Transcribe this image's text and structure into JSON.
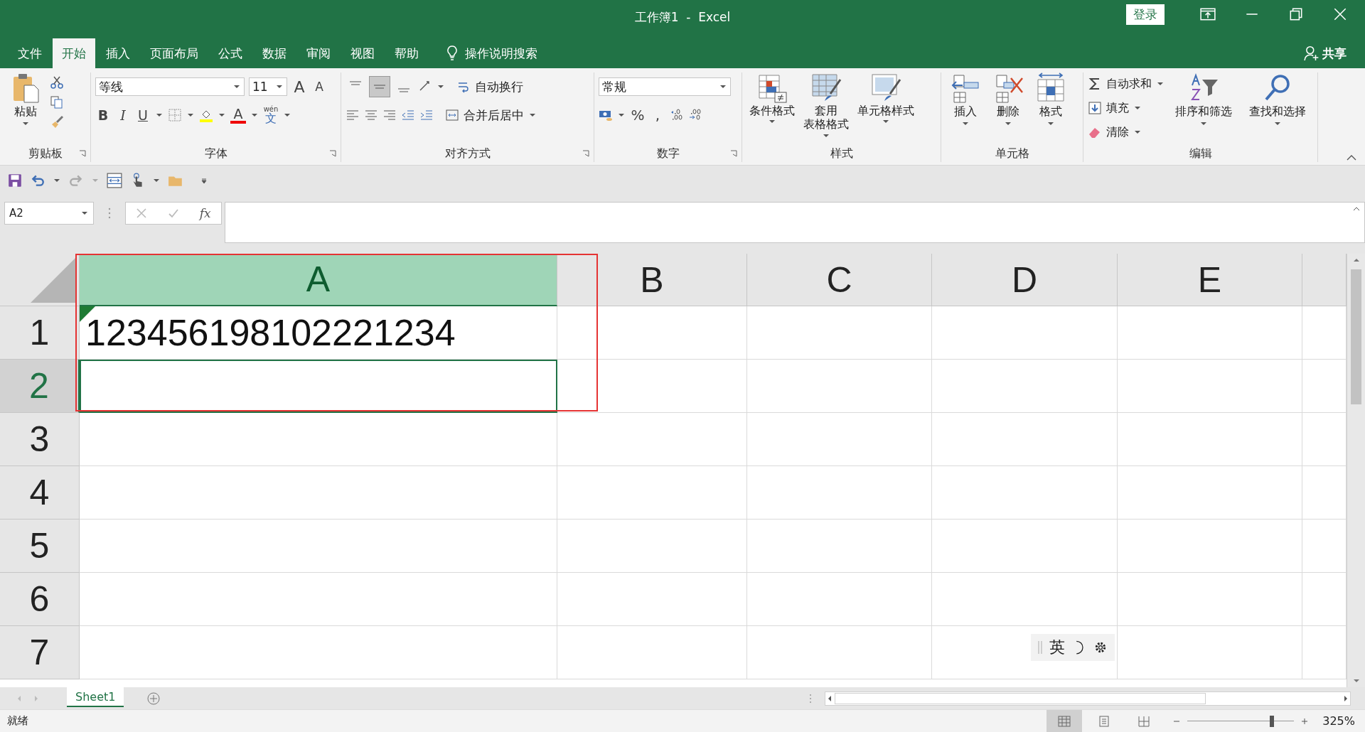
{
  "title_bar": {
    "title": "工作簿1  -  Excel",
    "login": "登录"
  },
  "tabs": [
    {
      "label": "文件",
      "selected": false
    },
    {
      "label": "开始",
      "selected": true
    },
    {
      "label": "插入",
      "selected": false
    },
    {
      "label": "页面布局",
      "selected": false
    },
    {
      "label": "公式",
      "selected": false
    },
    {
      "label": "数据",
      "selected": false
    },
    {
      "label": "审阅",
      "selected": false
    },
    {
      "label": "视图",
      "selected": false
    },
    {
      "label": "帮助",
      "selected": false
    }
  ],
  "tell_me": "操作说明搜索",
  "share": "共享",
  "ribbon": {
    "clipboard": {
      "paste": "粘贴",
      "label": "剪贴板"
    },
    "font": {
      "name": "等线",
      "size": "11",
      "label": "字体",
      "grow": "A",
      "shrink": "A",
      "bold": "B",
      "italic": "I",
      "underline": "U",
      "font_color_letter": "A",
      "phonetic_top": "wén",
      "phonetic": "文"
    },
    "alignment": {
      "vertical": [
        {
          "kind": "top",
          "selected": false
        },
        {
          "kind": "middle",
          "selected": true
        },
        {
          "kind": "bottom",
          "selected": false
        }
      ],
      "wrap": "自动换行",
      "merge": "合并后居中",
      "label": "对齐方式"
    },
    "number": {
      "format": "常规",
      "percent": "%",
      "comma": ",",
      "label": "数字"
    },
    "styles": {
      "buttons": [
        {
          "kind": "conditional",
          "lines": [
            "条件格式"
          ]
        },
        {
          "kind": "table",
          "lines": [
            "套用",
            "表格格式"
          ]
        },
        {
          "kind": "cell",
          "lines": [
            "单元格样式"
          ]
        }
      ],
      "label": "样式"
    },
    "cells": {
      "buttons": [
        {
          "kind": "insert",
          "label": "插入"
        },
        {
          "kind": "delete",
          "label": "删除"
        },
        {
          "kind": "format",
          "label": "格式"
        }
      ],
      "label": "单元格"
    },
    "editing": {
      "items": [
        {
          "kind": "sum",
          "label": "自动求和"
        },
        {
          "kind": "fill",
          "label": "填充"
        },
        {
          "kind": "clear",
          "label": "清除"
        }
      ],
      "buttons": [
        {
          "kind": "sort",
          "label": "排序和筛选"
        },
        {
          "kind": "find",
          "label": "查找和选择"
        }
      ],
      "label": "编辑"
    }
  },
  "formula_bar": {
    "name_box": "A2",
    "fx": "fx"
  },
  "grid": {
    "columns": [
      {
        "label": "A",
        "selected": true
      },
      {
        "label": "B",
        "selected": false
      },
      {
        "label": "C",
        "selected": false
      },
      {
        "label": "D",
        "selected": false
      },
      {
        "label": "E",
        "selected": false
      }
    ],
    "rows": [
      {
        "label": "1",
        "selected": false,
        "cells": [
          "123456198102221234",
          "",
          "",
          "",
          ""
        ],
        "error_flag": true
      },
      {
        "label": "2",
        "selected": true,
        "cells": [
          "",
          "",
          "",
          "",
          ""
        ],
        "error_flag": false
      },
      {
        "label": "3",
        "selected": false,
        "cells": [
          "",
          "",
          "",
          "",
          ""
        ],
        "error_flag": false
      },
      {
        "label": "4",
        "selected": false,
        "cells": [
          "",
          "",
          "",
          "",
          ""
        ],
        "error_flag": false
      },
      {
        "label": "5",
        "selected": false,
        "cells": [
          "",
          "",
          "",
          "",
          ""
        ],
        "error_flag": false
      },
      {
        "label": "6",
        "selected": false,
        "cells": [
          "",
          "",
          "",
          "",
          ""
        ],
        "error_flag": false
      },
      {
        "label": "7",
        "selected": false,
        "cells": [
          "",
          "",
          "",
          "",
          ""
        ],
        "error_flag": false
      }
    ],
    "highlight": true
  },
  "ime_bar": {
    "mode": "英"
  },
  "sheet_tabs": [
    {
      "label": "Sheet1",
      "selected": true
    }
  ],
  "status_bar": {
    "status": "就绪",
    "views": [
      {
        "kind": "normal",
        "selected": true
      },
      {
        "kind": "page_layout",
        "selected": false
      },
      {
        "kind": "page_break",
        "selected": false
      }
    ],
    "zoom": {
      "level": 0.79,
      "reading": "325%"
    }
  }
}
